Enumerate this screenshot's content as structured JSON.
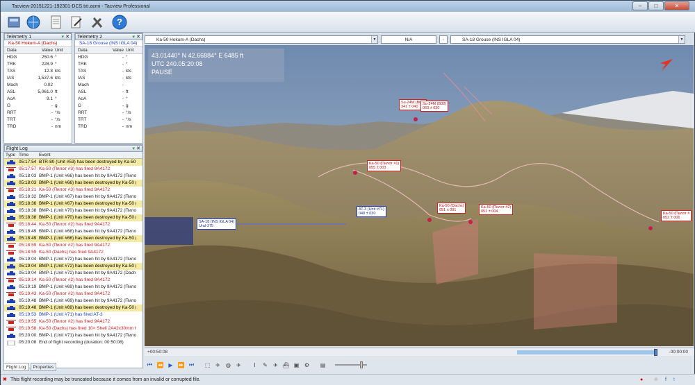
{
  "window": {
    "title": "Tacview-20151221-192301-DCS.txt.acmi - Tacview Professional"
  },
  "telemetry": [
    {
      "title": "Telemetry 1",
      "object": "Ka-50 Hokum-A (Dachs)",
      "headers": [
        "Data",
        "Value",
        "Unit"
      ],
      "rows": [
        [
          "HDG",
          "250.6",
          "°"
        ],
        [
          "TRK",
          "228.9",
          "°"
        ],
        [
          "TAS",
          "12.8",
          "kts"
        ],
        [
          "IAS",
          "1,537.6",
          "kts"
        ],
        [
          "Mach",
          "0.02",
          ""
        ],
        [
          "ASL",
          "5,061.0",
          "ft"
        ],
        [
          "AoA",
          "9.1",
          "°"
        ],
        [
          "G",
          "-",
          "g"
        ],
        [
          "RRT",
          "-",
          "°/s"
        ],
        [
          "TRT",
          "-",
          "°/s"
        ],
        [
          "TRD",
          "-",
          "nm"
        ]
      ]
    },
    {
      "title": "Telemetry 2",
      "object": "SA-18 Grouse (INS IGLA 04)",
      "headers": [
        "Data",
        "Value",
        "Unit"
      ],
      "rows": [
        [
          "HDG",
          "-",
          "°"
        ],
        [
          "TRK",
          "-",
          "°"
        ],
        [
          "TAS",
          "-",
          "kts"
        ],
        [
          "IAS",
          "-",
          "kts"
        ],
        [
          "Mach",
          "-",
          ""
        ],
        [
          "ASL",
          "-",
          "ft"
        ],
        [
          "AoA",
          "-",
          "°"
        ],
        [
          "G",
          "-",
          "g"
        ],
        [
          "RRT",
          "-",
          "°/s"
        ],
        [
          "TRT",
          "-",
          "°/s"
        ],
        [
          "TRD",
          "-",
          "nm"
        ]
      ]
    }
  ],
  "flightlog": {
    "title": "Flight Log",
    "headers": [
      "Type",
      "Time",
      "Event"
    ],
    "rows": [
      {
        "icon": "tank-blue",
        "time": "05:17:54",
        "event": "BTR-80 (Unit #53) has been destroyed by Ka-50 (",
        "style": "hl"
      },
      {
        "icon": "heli-red",
        "time": "05:17:57",
        "event": "Ka-50 (Пилот #3) has fired 9A4172",
        "style": "red"
      },
      {
        "icon": "tank-blue",
        "time": "05:18:03",
        "event": "BMP-1 (Unit #66) has been hit by 9A4172 (Пилот",
        "style": "blk"
      },
      {
        "icon": "tank-blue",
        "time": "05:18:03",
        "event": "BMP-1 (Unit #66) has been destroyed by Ka-50 (",
        "style": "hl"
      },
      {
        "icon": "heli-red",
        "time": "05:18:21",
        "event": "Ka-50 (Пилот #3) has fired 9A4172",
        "style": "red"
      },
      {
        "icon": "tank-blue",
        "time": "05:18:32",
        "event": "BMP-1 (Unit #67) has been hit by 9A4172 (Пилот",
        "style": "blk"
      },
      {
        "icon": "tank-blue",
        "time": "05:18:36",
        "event": "BMP-1 (Unit #67) has been destroyed by Ka-50 (",
        "style": "hl"
      },
      {
        "icon": "tank-blue",
        "time": "05:18:38",
        "event": "BMP-1 (Unit #70) has been hit by 9A4172 (Пилот",
        "style": "blk"
      },
      {
        "icon": "tank-blue",
        "time": "05:18:38",
        "event": "BMP-1 (Unit #70) has been destroyed by Ka-50 (",
        "style": "hl"
      },
      {
        "icon": "heli-red",
        "time": "05:18:44",
        "event": "Ka-50 (Пилот #2) has fired 9A4172",
        "style": "red"
      },
      {
        "icon": "tank-blue",
        "time": "05:18:49",
        "event": "BMP-1 (Unit #68) has been hit by 9A4172 (Пилот",
        "style": "blk"
      },
      {
        "icon": "tank-blue",
        "time": "05:18:49",
        "event": "BMP-1 (Unit #68) has been destroyed by Ka-50 (",
        "style": "hl"
      },
      {
        "icon": "heli-red",
        "time": "05:18:59",
        "event": "Ka-50 (Пилот #2) has fired 9A4172",
        "style": "red"
      },
      {
        "icon": "heli-red",
        "time": "05:18:59",
        "event": "Ka-50 (Dachs) has fired 9A4172",
        "style": "red"
      },
      {
        "icon": "tank-blue",
        "time": "05:19:04",
        "event": "BMP-1 (Unit #72) has been hit by 9A4172 (Пилот",
        "style": "blk"
      },
      {
        "icon": "tank-blue",
        "time": "05:19:04",
        "event": "BMP-1 (Unit #72) has been destroyed by Ka-50 (",
        "style": "hl"
      },
      {
        "icon": "tank-blue",
        "time": "05:19:04",
        "event": "BMP-1 (Unit #72) has been hit by 9A4172 (Dachs)",
        "style": "blk"
      },
      {
        "icon": "heli-red",
        "time": "05:19:14",
        "event": "Ka-50 (Пилот #2) has fired 9A4172",
        "style": "red"
      },
      {
        "icon": "tank-blue",
        "time": "05:19:19",
        "event": "BMP-1 (Unit #69) has been hit by 9A4172 (Пилот",
        "style": "blk"
      },
      {
        "icon": "heli-red",
        "time": "05:19:43",
        "event": "Ka-50 (Пилот #2) has fired 9A4172",
        "style": "red"
      },
      {
        "icon": "tank-blue",
        "time": "05:19:48",
        "event": "BMP-1 (Unit #69) has been hit by 9A4172 (Пилот",
        "style": "blk"
      },
      {
        "icon": "tank-blue",
        "time": "05:19:48",
        "event": "BMP-1 (Unit #69) has been destroyed by Ka-50 (",
        "style": "hl"
      },
      {
        "icon": "tank-blue",
        "time": "05:19:53",
        "event": "BMP-1 (Unit #71) has fired AT-3",
        "style": "blue"
      },
      {
        "icon": "heli-red",
        "time": "05:19:55",
        "event": "Ka-50 (Пилот #2) has fired 9A4172",
        "style": "red"
      },
      {
        "icon": "heli-red",
        "time": "05:19:58",
        "event": "Ka-50 (Dachs) has fired 10× Shell 2A42x30mm HE",
        "style": "red"
      },
      {
        "icon": "tank-blue",
        "time": "05:20:00",
        "event": "BMP-1 (Unit #71) has been hit by 9A4172 (Пилот",
        "style": "blk"
      },
      {
        "icon": "info",
        "time": "05:20:08",
        "event": "End of flight recording (duration: 00:50:08)",
        "style": "blk"
      }
    ]
  },
  "tabs": [
    "Flight Log",
    "Properties"
  ],
  "viewheader": {
    "left_object": "Ka-50 Hokum-A (Dachs)",
    "center": "N/A",
    "minus": "-",
    "right_object": "SA-18 Grouse (INS IGLA 04)"
  },
  "hud": {
    "line1": "43.01440° N  42.66884° E  6485 ft",
    "line2": "UTC 240.05:20:08",
    "line3": "PAUSE"
  },
  "labels": [
    {
      "text": "Su-24M (B01)\n341 ± 040",
      "style": "r"
    },
    {
      "text": "Su-24M (B02)\n063 ± 030",
      "style": "r"
    },
    {
      "text": "Ka-50 (Пилот #1)\n055 ± 003",
      "style": "r"
    },
    {
      "text": "AT-3 (Unit #71)\n048 ± 030",
      "style": "b"
    },
    {
      "text": "SA-18 (INS IGLA 04)\nUral-375",
      "style": "b"
    },
    {
      "text": "Ka-50 (Dachs)\n051 ± 001",
      "style": "r"
    },
    {
      "text": "Ka-50 (Пилот #2)\n051 ± 004",
      "style": "r"
    },
    {
      "text": "Ka-50 (Пилот #\n052 ± 006",
      "style": "r"
    }
  ],
  "timeline": {
    "start": "+00:50:08",
    "end": "-00:00:00",
    "progress": 0.99
  },
  "status": {
    "message": "This flight recording may be truncated because it comes from an invalid or corrupted file."
  },
  "colors": {
    "accent": "#2a5dc4",
    "red": "#d01a1a",
    "highlight": "#f5eaa3"
  }
}
